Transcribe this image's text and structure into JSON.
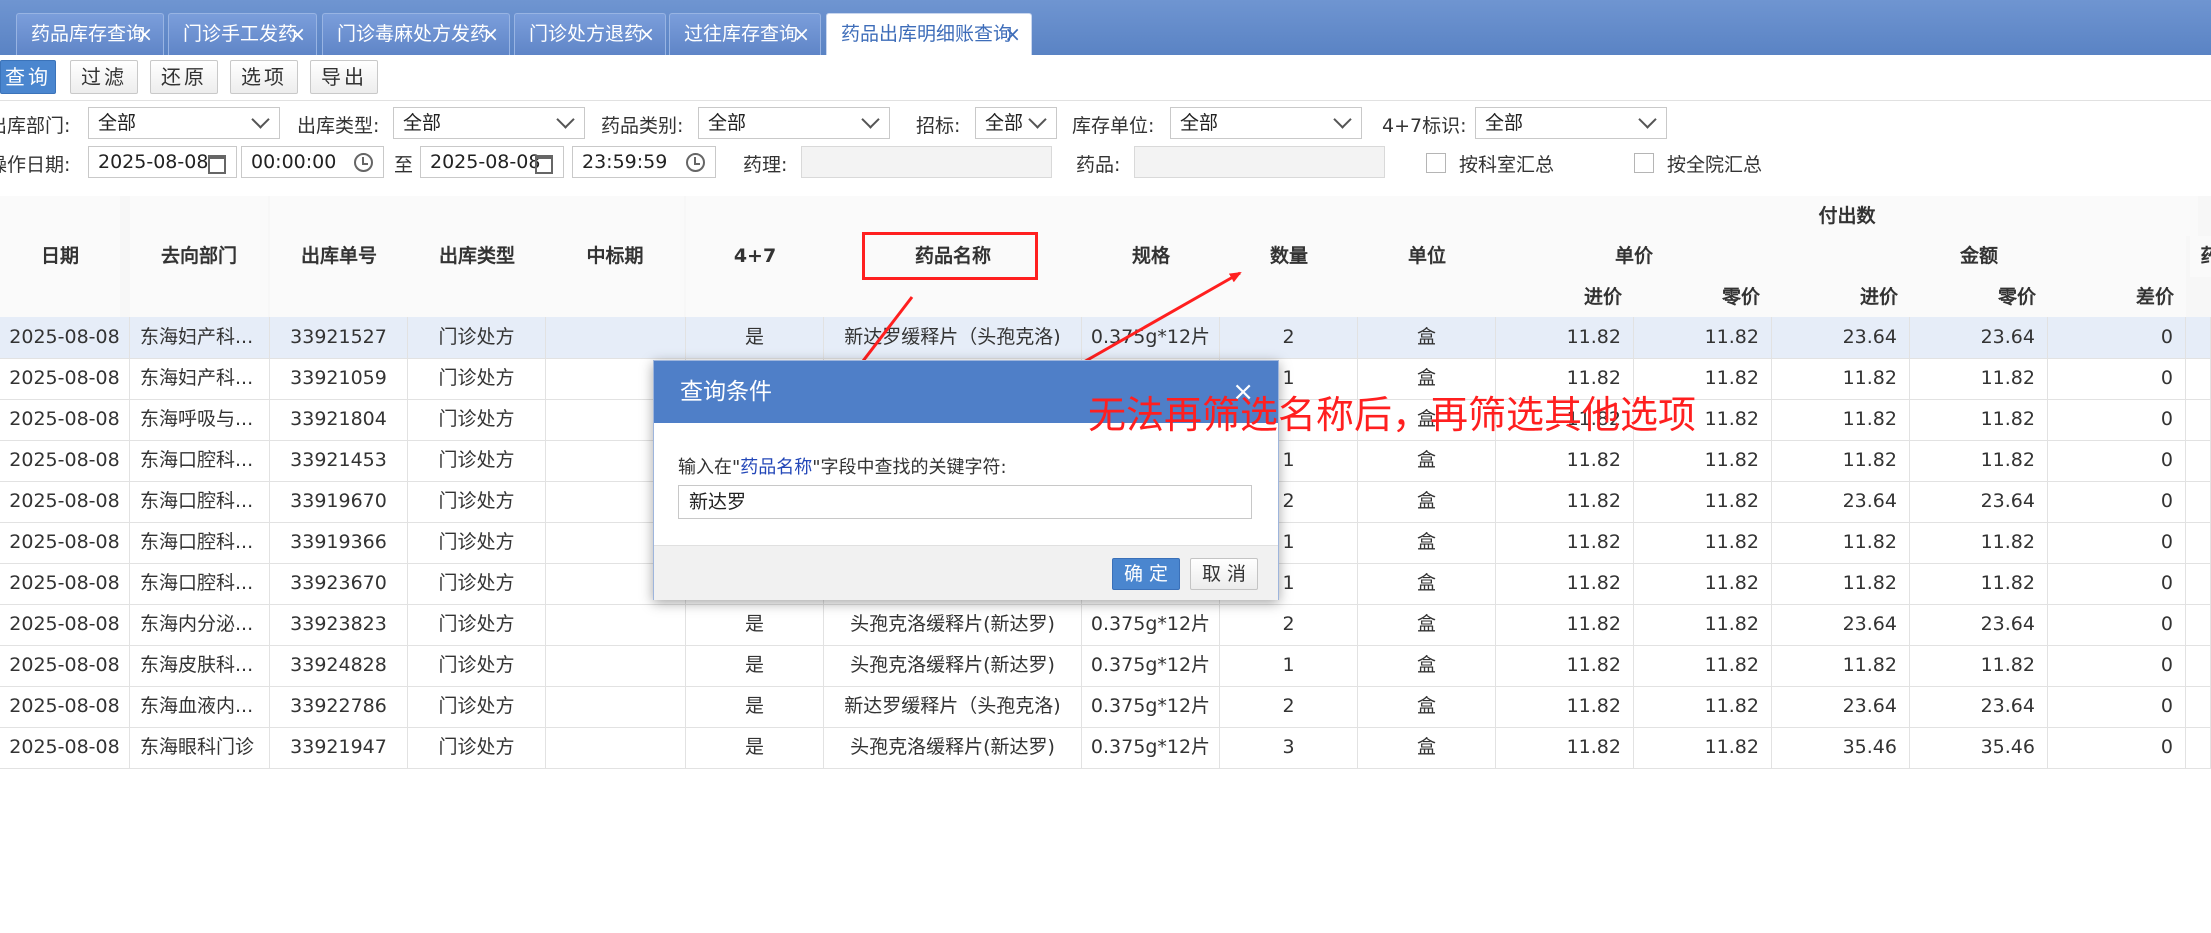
{
  "tabs": [
    {
      "label": "药品库存查询"
    },
    {
      "label": "门诊手工发药"
    },
    {
      "label": "门诊毒麻处方发药"
    },
    {
      "label": "门诊处方退药"
    },
    {
      "label": "过往库存查询"
    },
    {
      "label": "药品出库明细账查询",
      "active": true
    }
  ],
  "toolbar": {
    "query": "查询",
    "filter": "过滤",
    "restore": "还原",
    "options": "选项",
    "export": "导出"
  },
  "filters": {
    "dept_label": "出库部门:",
    "dept_value": "全部",
    "type_label": "出库类型:",
    "type_value": "全部",
    "category_label": "药品类别:",
    "category_value": "全部",
    "bid_label": "招标:",
    "bid_value": "全部",
    "unit_label": "库存单位:",
    "unit_value": "全部",
    "flag47_label": "4+7标识:",
    "flag47_value": "全部",
    "date_label": "操作日期:",
    "start_date": "2025-08-08",
    "start_time": "00:00:00",
    "to_label": "至",
    "end_date": "2025-08-08",
    "end_time": "23:59:59",
    "pharmacology_label": "药理:",
    "pharmacology_value": "",
    "drug_label": "药品:",
    "drug_value": "",
    "by_dept_label": "按科室汇总",
    "by_hospital_label": "按全院汇总"
  },
  "grid": {
    "headers": {
      "date": "日期",
      "dept": "去向部门",
      "order_no": "出库单号",
      "type": "出库类型",
      "bid_period": "中标期",
      "four_seven": "4+7",
      "name": "药品名称",
      "spec": "规格",
      "qty": "数量",
      "unit": "单位",
      "paid_out": "付出数",
      "unit_price": "单价",
      "amount": "金额",
      "purchase": "进价",
      "retail": "零价",
      "amt_purchase": "进价",
      "amt_retail": "零价",
      "diff": "差价",
      "drug_partial": "药"
    },
    "rows": [
      {
        "date": "2025-08-08",
        "dept": "东海妇产科...",
        "order_no": "33921527",
        "type": "门诊处方",
        "bid_period": "",
        "four_seven": "是",
        "name": "新达罗缓释片（头孢克洛)",
        "spec": "0.375g*12片",
        "qty": "2",
        "unit": "盒",
        "price_in": "11.82",
        "price_retail": "11.82",
        "amt_in": "23.64",
        "amt_retail": "23.64",
        "diff": "0",
        "selected": true
      },
      {
        "date": "2025-08-08",
        "dept": "东海妇产科...",
        "order_no": "33921059",
        "type": "门诊处方",
        "bid_period": "",
        "four_seven": "",
        "name": "",
        "spec": "",
        "qty": "1",
        "unit": "盒",
        "price_in": "11.82",
        "price_retail": "11.82",
        "amt_in": "11.82",
        "amt_retail": "11.82",
        "diff": "0"
      },
      {
        "date": "2025-08-08",
        "dept": "东海呼吸与...",
        "order_no": "33921804",
        "type": "门诊处方",
        "bid_period": "",
        "four_seven": "",
        "name": "",
        "spec": "",
        "qty": "",
        "unit": "盒",
        "price_in": "11.82",
        "price_retail": "11.82",
        "amt_in": "11.82",
        "amt_retail": "11.82",
        "diff": "0"
      },
      {
        "date": "2025-08-08",
        "dept": "东海口腔科...",
        "order_no": "33921453",
        "type": "门诊处方",
        "bid_period": "",
        "four_seven": "",
        "name": "",
        "spec": "",
        "qty": "1",
        "unit": "盒",
        "price_in": "11.82",
        "price_retail": "11.82",
        "amt_in": "11.82",
        "amt_retail": "11.82",
        "diff": "0"
      },
      {
        "date": "2025-08-08",
        "dept": "东海口腔科...",
        "order_no": "33919670",
        "type": "门诊处方",
        "bid_period": "",
        "four_seven": "",
        "name": "",
        "spec": "",
        "qty": "2",
        "unit": "盒",
        "price_in": "11.82",
        "price_retail": "11.82",
        "amt_in": "23.64",
        "amt_retail": "23.64",
        "diff": "0"
      },
      {
        "date": "2025-08-08",
        "dept": "东海口腔科...",
        "order_no": "33919366",
        "type": "门诊处方",
        "bid_period": "",
        "four_seven": "",
        "name": "",
        "spec": "",
        "qty": "1",
        "unit": "盒",
        "price_in": "11.82",
        "price_retail": "11.82",
        "amt_in": "11.82",
        "amt_retail": "11.82",
        "diff": "0"
      },
      {
        "date": "2025-08-08",
        "dept": "东海口腔科...",
        "order_no": "33923670",
        "type": "门诊处方",
        "bid_period": "",
        "four_seven": "",
        "name": "",
        "spec": "",
        "qty": "1",
        "unit": "盒",
        "price_in": "11.82",
        "price_retail": "11.82",
        "amt_in": "11.82",
        "amt_retail": "11.82",
        "diff": "0"
      },
      {
        "date": "2025-08-08",
        "dept": "东海内分泌...",
        "order_no": "33923823",
        "type": "门诊处方",
        "bid_period": "",
        "four_seven": "是",
        "name": "头孢克洛缓释片(新达罗)",
        "spec": "0.375g*12片",
        "qty": "2",
        "unit": "盒",
        "price_in": "11.82",
        "price_retail": "11.82",
        "amt_in": "23.64",
        "amt_retail": "23.64",
        "diff": "0"
      },
      {
        "date": "2025-08-08",
        "dept": "东海皮肤科...",
        "order_no": "33924828",
        "type": "门诊处方",
        "bid_period": "",
        "four_seven": "是",
        "name": "头孢克洛缓释片(新达罗)",
        "spec": "0.375g*12片",
        "qty": "1",
        "unit": "盒",
        "price_in": "11.82",
        "price_retail": "11.82",
        "amt_in": "11.82",
        "amt_retail": "11.82",
        "diff": "0"
      },
      {
        "date": "2025-08-08",
        "dept": "东海血液内...",
        "order_no": "33922786",
        "type": "门诊处方",
        "bid_period": "",
        "four_seven": "是",
        "name": "新达罗缓释片（头孢克洛)",
        "spec": "0.375g*12片",
        "qty": "2",
        "unit": "盒",
        "price_in": "11.82",
        "price_retail": "11.82",
        "amt_in": "23.64",
        "amt_retail": "23.64",
        "diff": "0"
      },
      {
        "date": "2025-08-08",
        "dept": "东海眼科门诊",
        "order_no": "33921947",
        "type": "门诊处方",
        "bid_period": "",
        "four_seven": "是",
        "name": "头孢克洛缓释片(新达罗)",
        "spec": "0.375g*12片",
        "qty": "3",
        "unit": "盒",
        "price_in": "11.82",
        "price_retail": "11.82",
        "amt_in": "35.46",
        "amt_retail": "35.46",
        "diff": "0"
      }
    ]
  },
  "dialog": {
    "title": "查询条件",
    "close": "×",
    "prompt_prefix": "输入在\"",
    "prompt_field": "药品名称",
    "prompt_suffix": "\"字段中查找的关键字符:",
    "input_value": "新达罗",
    "ok_label": "确 定",
    "cancel_label": "取 消"
  },
  "annotation": {
    "text": "无法再筛选名称后，再筛选其他选项",
    "color": "#ff1f1f"
  },
  "colors": {
    "tab_bar": "#5a83c4",
    "accent": "#4a86cf",
    "selected_row": "#e6edf8"
  }
}
